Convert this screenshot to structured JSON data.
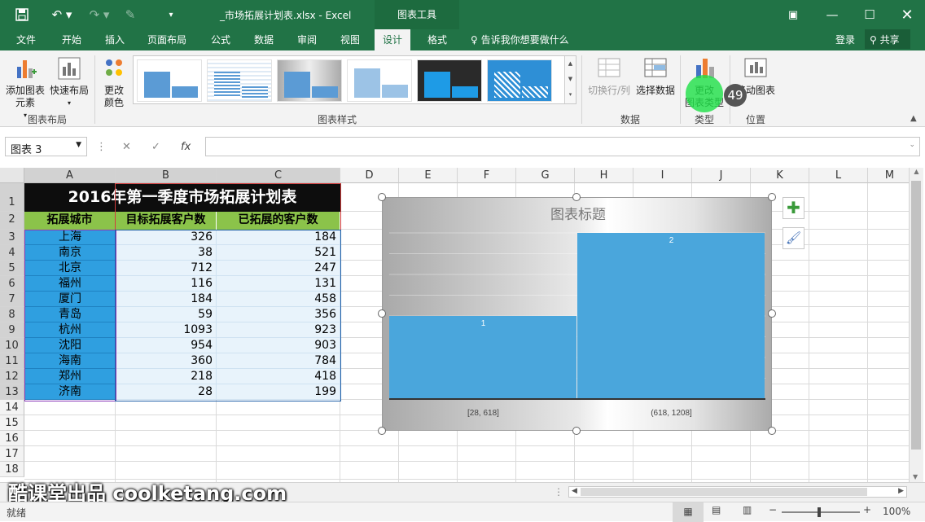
{
  "window": {
    "doc_title": "_市场拓展计划表.xlsx - Excel",
    "context_tab": "图表工具"
  },
  "menu": {
    "items": [
      "文件",
      "开始",
      "插入",
      "页面布局",
      "公式",
      "数据",
      "审阅",
      "视图",
      "设计",
      "格式"
    ],
    "active": "设计",
    "tellme": "告诉我你想要做什么",
    "login": "登录",
    "share": "共享"
  },
  "ribbon": {
    "add_element": "添加图表\n元素",
    "quick_layout": "快速布局",
    "change_colors": "更改\n颜色",
    "group_layout": "图表布局",
    "group_styles": "图表样式",
    "switch_row_col": "切换行/列",
    "select_data": "选择数据",
    "group_data": "数据",
    "change_type": "更改\n图表类型",
    "group_type": "类型",
    "move_chart": "移动图表",
    "group_location": "位置",
    "badge": "49"
  },
  "formula": {
    "name_box": "图表 3",
    "fx": "fx"
  },
  "columns": [
    "A",
    "B",
    "C",
    "D",
    "E",
    "F",
    "G",
    "H",
    "I",
    "J",
    "K",
    "L",
    "M"
  ],
  "rows": [
    "1",
    "2",
    "3",
    "4",
    "5",
    "6",
    "7",
    "8",
    "9",
    "10",
    "11",
    "12",
    "13",
    "14",
    "15",
    "16",
    "17",
    "18"
  ],
  "table": {
    "title": "2016年第一季度市场拓展计划表",
    "headers": [
      "拓展城市",
      "目标拓展客户数",
      "已拓展的客户数"
    ],
    "rows": [
      [
        "上海",
        "326",
        "184"
      ],
      [
        "南京",
        "38",
        "521"
      ],
      [
        "北京",
        "712",
        "247"
      ],
      [
        "福州",
        "116",
        "131"
      ],
      [
        "厦门",
        "184",
        "458"
      ],
      [
        "青岛",
        "59",
        "356"
      ],
      [
        "杭州",
        "1093",
        "923"
      ],
      [
        "沈阳",
        "954",
        "903"
      ],
      [
        "海南",
        "360",
        "784"
      ],
      [
        "郑州",
        "218",
        "418"
      ],
      [
        "济南",
        "28",
        "199"
      ]
    ]
  },
  "chart_data": {
    "type": "bar",
    "title": "图表标题",
    "categories": [
      "[28, 618]",
      "(618, 1208]"
    ],
    "values": [
      1,
      2
    ],
    "data_labels": [
      "1",
      "2"
    ],
    "note": "histogram bins",
    "color": "#4aa6dc"
  },
  "status": {
    "ready": "就绪",
    "zoom": "100%"
  },
  "watermark": "酷课堂出品 coolketang.com"
}
